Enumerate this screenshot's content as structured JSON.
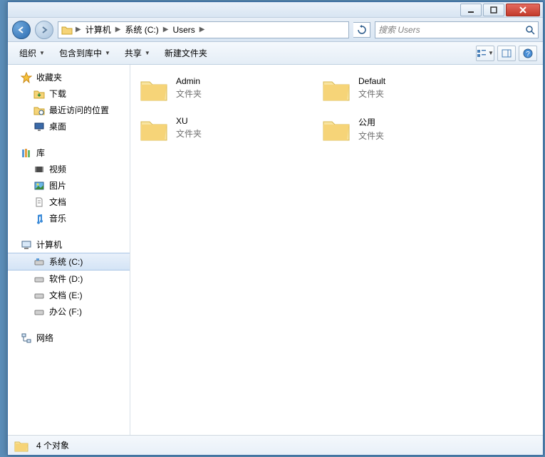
{
  "breadcrumb": {
    "items": [
      "计算机",
      "系统 (C:)",
      "Users"
    ]
  },
  "search": {
    "placeholder": "搜索 Users"
  },
  "toolbar": {
    "organize": "组织",
    "include": "包含到库中",
    "share": "共享",
    "newfolder": "新建文件夹"
  },
  "sidebar": {
    "favorites": {
      "label": "收藏夹",
      "items": [
        "下载",
        "最近访问的位置",
        "桌面"
      ]
    },
    "libraries": {
      "label": "库",
      "items": [
        "视频",
        "图片",
        "文档",
        "音乐"
      ]
    },
    "computer": {
      "label": "计算机",
      "items": [
        "系统 (C:)",
        "软件 (D:)",
        "文档 (E:)",
        "办公 (F:)"
      ],
      "selected": 0
    },
    "network": {
      "label": "网络"
    }
  },
  "content": {
    "type_label": "文件夹",
    "items": [
      {
        "name": "Admin"
      },
      {
        "name": "Default"
      },
      {
        "name": "XU"
      },
      {
        "name": "公用"
      }
    ]
  },
  "status": {
    "count_text": "4 个对象"
  }
}
